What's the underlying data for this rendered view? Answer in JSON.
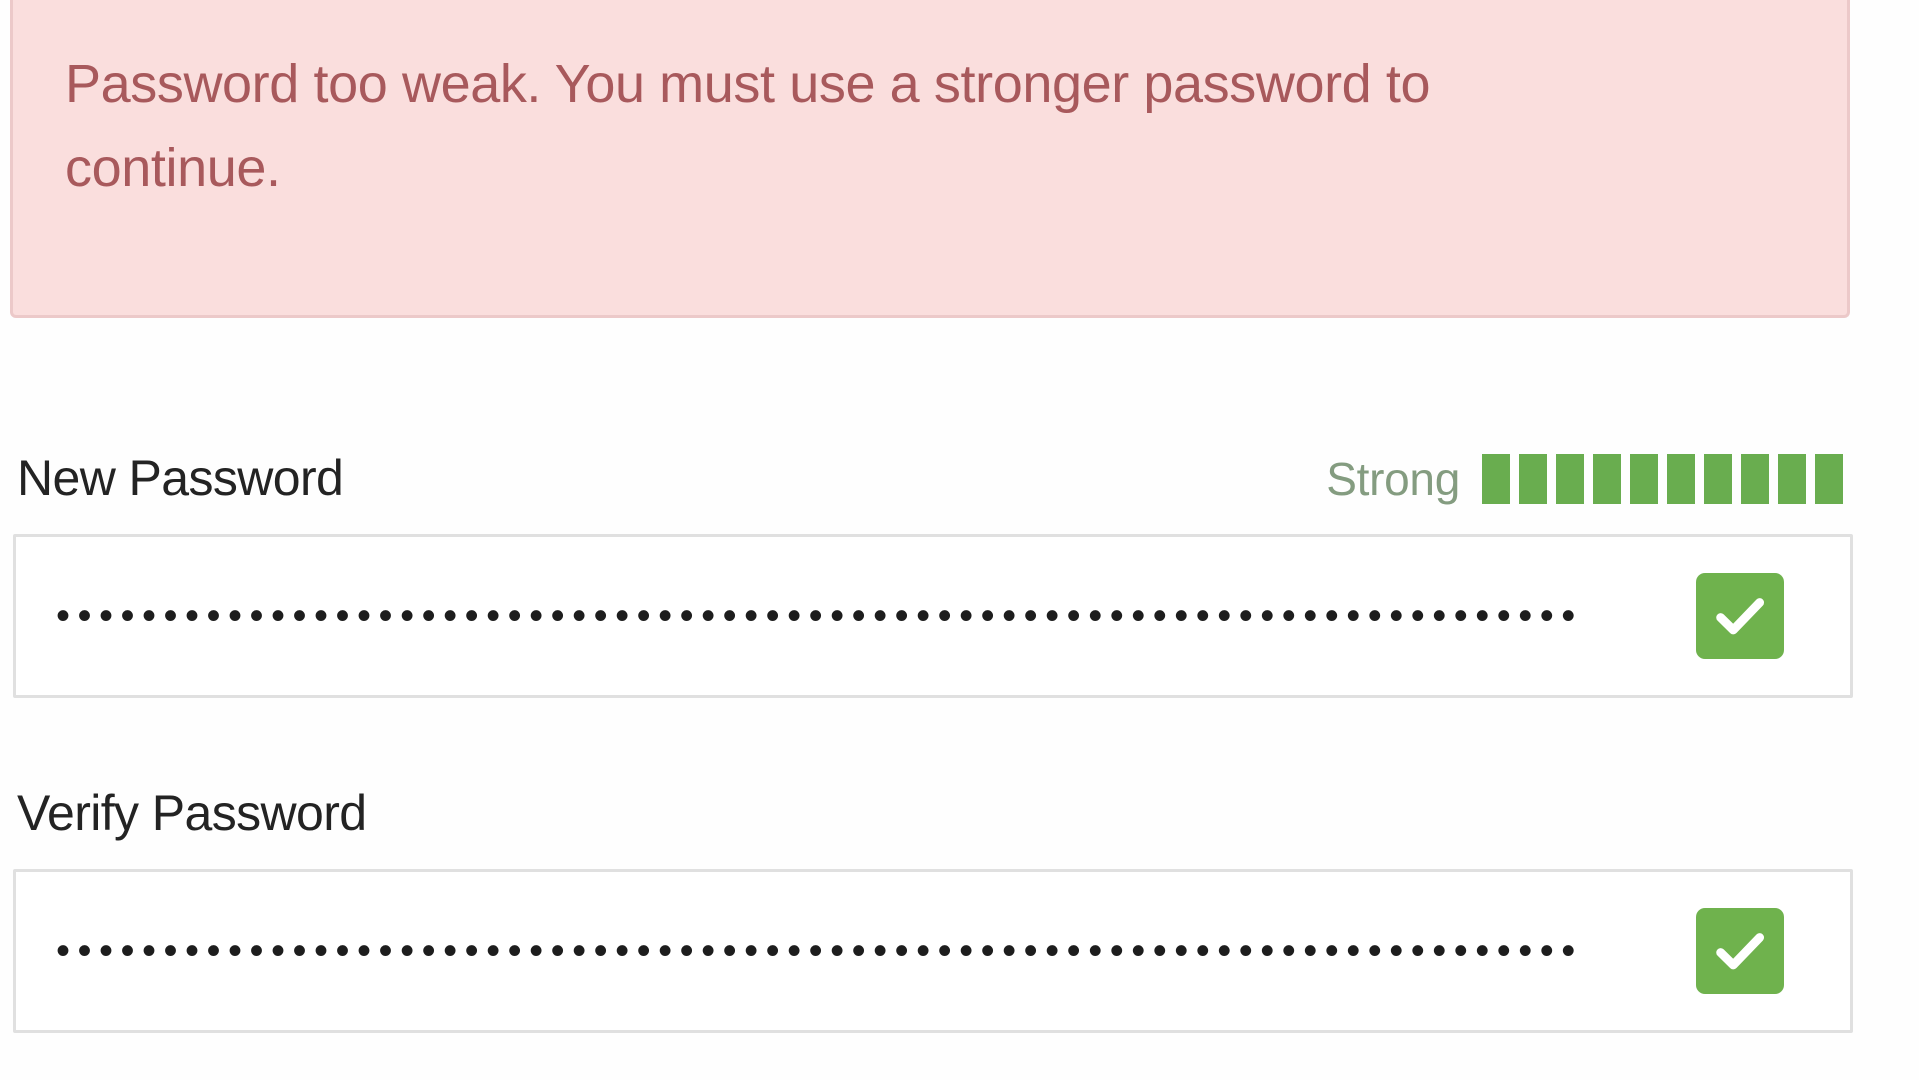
{
  "alert": {
    "type": "error",
    "message": "Password too weak. You must use a stronger password to continue.",
    "background_color": "#fadedd",
    "border_color": "#ecc9c9",
    "text_color": "#a8595c"
  },
  "fields": {
    "new_password": {
      "label": "New Password",
      "value_masked": "•••••••••••••••••••••••••••••••••••••••••••••••••••••••••••••••••••••••",
      "placeholder": "",
      "valid": true,
      "valid_icon": "check-icon",
      "strength": {
        "label": "Strong",
        "filled_bars": 10,
        "total_bars": 10,
        "label_color": "#849c80",
        "bar_color": "#69ad4f"
      }
    },
    "verify_password": {
      "label": "Verify Password",
      "value_masked": "•••••••••••••••••••••••••••••••••••••••••••••••••••••••••••••••••••••••",
      "placeholder": "",
      "valid": true,
      "valid_icon": "check-icon"
    }
  },
  "colors": {
    "valid_badge": "#6fb24d",
    "input_border": "#e0e0e0",
    "label_text": "#232323",
    "page_background": "#fefefe"
  }
}
